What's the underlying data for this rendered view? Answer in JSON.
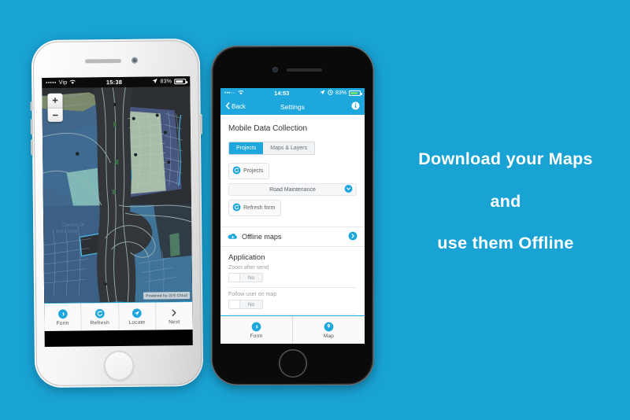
{
  "theme": {
    "background": "#19a3d5",
    "accent": "#1ea7dd",
    "headline_color": "#ffffff"
  },
  "headline": {
    "line1": "Download your Maps",
    "line2": "and",
    "line3": "use them Offline"
  },
  "phone_map": {
    "device": "white-iphone",
    "status_bar": {
      "signal_dots": "•••••",
      "carrier": "Vip",
      "wifi_icon": "wifi-icon",
      "time": "15:38",
      "location_icon": "location-arrow-icon",
      "battery_percent": "83%",
      "battery_icon": "battery-icon"
    },
    "map": {
      "zoom_in_label": "+",
      "zoom_out_label": "−",
      "attribution": "Powered by GIS Cloud"
    },
    "toolbar": [
      {
        "label": "Form",
        "icon": "form-arrow-icon"
      },
      {
        "label": "Refresh",
        "icon": "refresh-icon"
      },
      {
        "label": "Locate",
        "icon": "locate-arrow-icon"
      },
      {
        "label": "Next",
        "icon": "chevron-right-icon"
      }
    ]
  },
  "phone_settings": {
    "device": "black-iphone",
    "status_bar": {
      "signal_dots": "•••◦◦",
      "wifi_icon": "wifi-icon",
      "time": "14:53",
      "location_icon": "location-arrow-icon",
      "alarm_icon": "alarm-icon",
      "battery_percent": "83%",
      "battery_icon": "battery-icon"
    },
    "navbar": {
      "back_label": "Back",
      "back_icon": "chevron-left-icon",
      "title": "Settings",
      "info_icon": "info-icon"
    },
    "mobile_data_collection": {
      "heading": "Mobile Data Collection",
      "segments": [
        {
          "label": "Projects",
          "active": true
        },
        {
          "label": "Maps & Layers",
          "active": false
        }
      ],
      "projects_button": {
        "label": "Projects",
        "icon": "refresh-icon"
      },
      "project_select": {
        "value": "Road Maintenance",
        "caret_icon": "chevron-down-icon"
      },
      "refresh_form_button": {
        "label": "Refresh form",
        "icon": "refresh-icon"
      },
      "offline_maps_row": {
        "label": "Offline maps",
        "icon": "cloud-download-icon",
        "chevron_icon": "chevron-right-icon"
      }
    },
    "application": {
      "heading": "Application",
      "settings": [
        {
          "label": "Zoom after send",
          "value": "No"
        },
        {
          "label": "Follow user on map",
          "value": "No"
        }
      ]
    },
    "toolbar": [
      {
        "label": "Form",
        "icon": "form-arrow-icon"
      },
      {
        "label": "Map",
        "icon": "map-pin-icon"
      }
    ]
  }
}
